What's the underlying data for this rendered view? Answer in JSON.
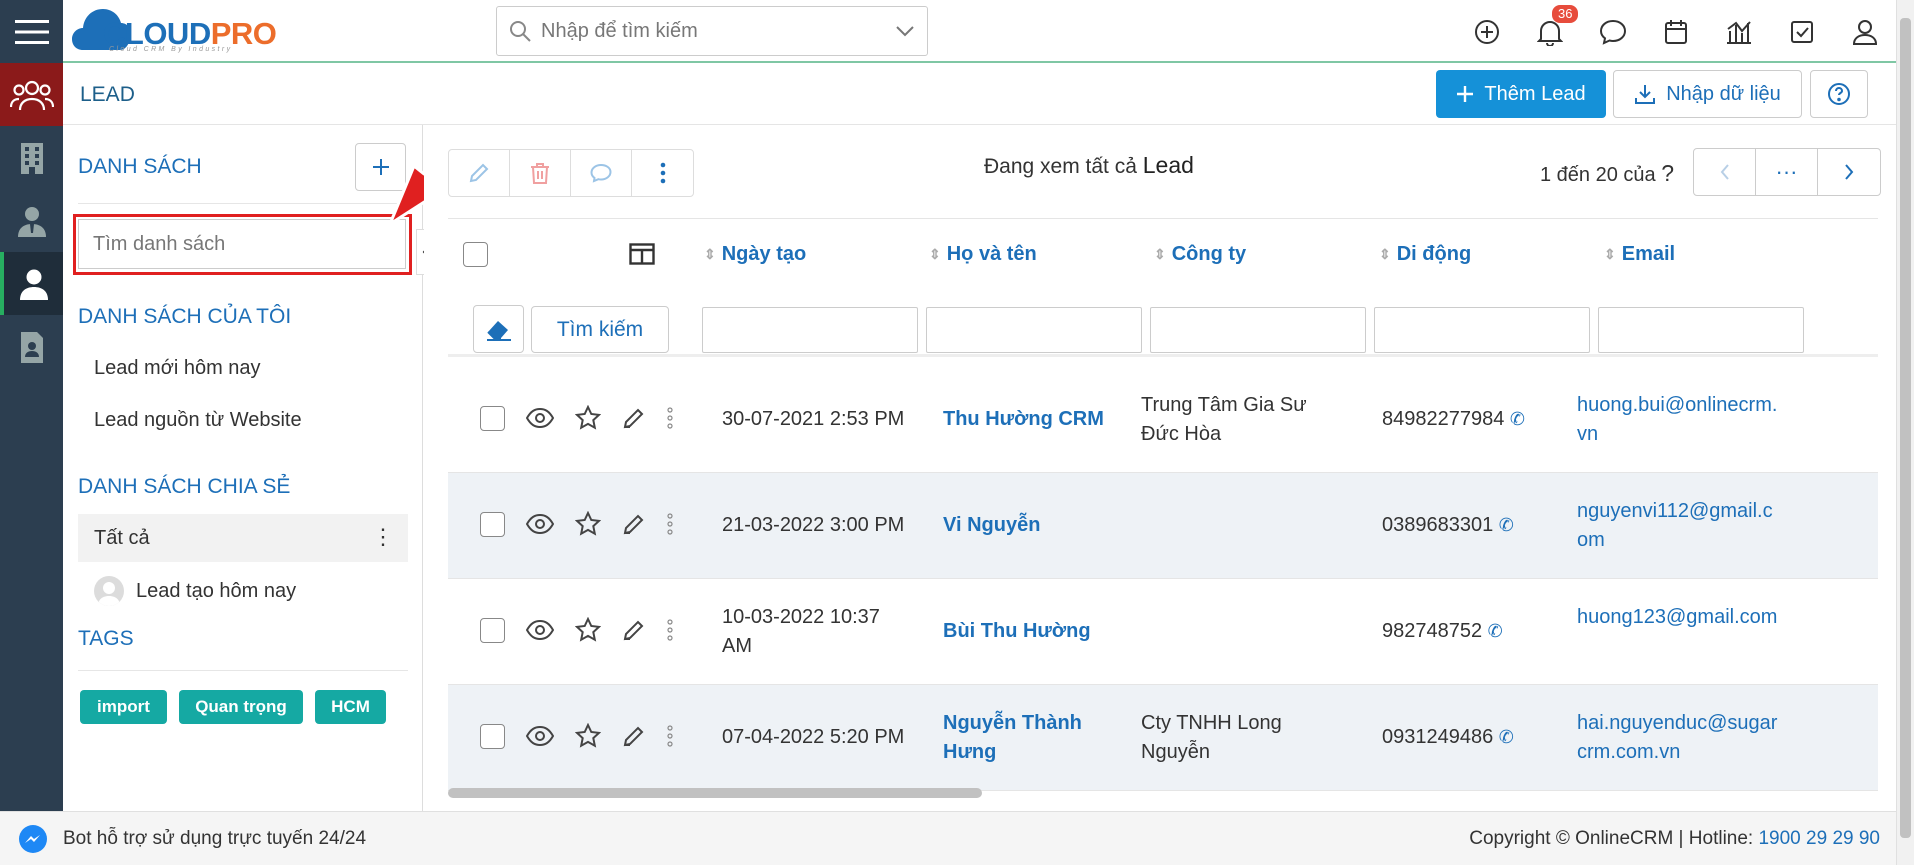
{
  "app": {
    "logo_cloud": "CLOUD",
    "logo_pro": "PRO",
    "logo_subtitle": "Cloud CRM By Industry",
    "search_placeholder": "Nhập để tìm kiếm",
    "notification_count": "36"
  },
  "header": {
    "title": "LEAD",
    "add_label": "Thêm Lead",
    "import_label": "Nhập dữ liệu"
  },
  "sidebar": {
    "lists_title": "DANH SÁCH",
    "search_placeholder": "Tìm danh sách",
    "my_lists_title": "DANH SÁCH CỦA TÔI",
    "my_lists": [
      "Lead mới hôm nay",
      "Lead nguồn từ Website"
    ],
    "shared_title": "DANH SÁCH CHIA SẺ",
    "shared_all": "Tất cả",
    "shared_item": "Lead tạo hôm nay",
    "tags_title": "TAGS",
    "tags": [
      "import",
      "Quan trọng",
      "HCM"
    ]
  },
  "table": {
    "viewing_prefix": "Đang xem tất cả",
    "viewing_module": "Lead",
    "pager_text": "1 đến 20 của",
    "pager_unknown": "?",
    "pager_more": "···",
    "columns": [
      "Ngày tạo",
      "Họ và tên",
      "Công ty",
      "Di động",
      "Email"
    ],
    "search_button": "Tìm kiếm",
    "rows": [
      {
        "date": "30-07-2021 2:53 PM",
        "name": "Thu Hường CRM",
        "company": "Trung Tâm Gia Sư Đức Hòa",
        "mobile": "84982277984",
        "email": "huong.bui@onlinecrm.vn"
      },
      {
        "date": "21-03-2022 3:00 PM",
        "name": "Vi Nguyễn",
        "company": "",
        "mobile": "0389683301",
        "email": "nguyenvi112@gmail.com"
      },
      {
        "date": "10-03-2022 10:37 AM",
        "name": "Bùi Thu Hường",
        "company": "",
        "mobile": "982748752",
        "email": "huong123@gmail.com"
      },
      {
        "date": "07-04-2022 5:20 PM",
        "name": "Nguyễn Thành Hưng",
        "company": "Cty TNHH Long Nguyễn",
        "mobile": "0931249486",
        "email": "hai.nguyenduc@sugarcrm.com.vn"
      }
    ]
  },
  "footer": {
    "bot_text": "Bot hỗ trợ sử dụng trực tuyến 24/24",
    "copyright": "Copyright © OnlineCRM | Hotline:",
    "hotline": "1900 29 29 90"
  },
  "colors": {
    "primary": "#1591d8",
    "link": "#1d6fb8",
    "rail": "#2c3e50",
    "leads_active": "#8b1a1a",
    "tag": "#15a9a3",
    "highlight": "#e02020"
  }
}
